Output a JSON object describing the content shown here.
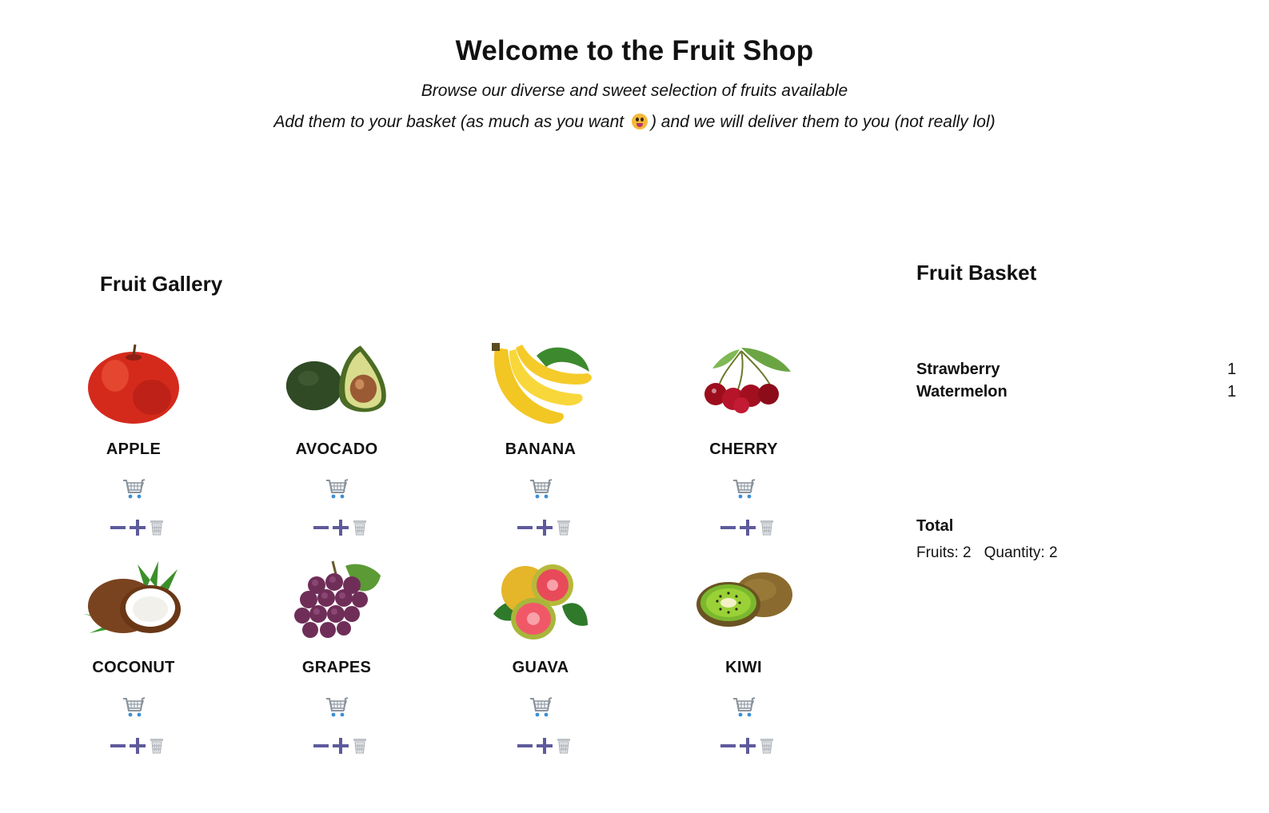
{
  "header": {
    "title": "Welcome to the Fruit Shop",
    "subtitle": "Browse our diverse and sweet selection of fruits available",
    "tagline_before": "Add them to your basket (as much as you want",
    "tagline_after": ") and we will deliver them to you (not really lol)"
  },
  "gallery": {
    "title": "Fruit Gallery",
    "fruits": [
      {
        "name": "APPLE"
      },
      {
        "name": "AVOCADO"
      },
      {
        "name": "BANANA"
      },
      {
        "name": "CHERRY"
      },
      {
        "name": "COCONUT"
      },
      {
        "name": "GRAPES"
      },
      {
        "name": "GUAVA"
      },
      {
        "name": "KIWI"
      }
    ]
  },
  "basket": {
    "title": "Fruit Basket",
    "items": [
      {
        "name": "Strawberry",
        "qty": "1"
      },
      {
        "name": "Watermelon",
        "qty": "1"
      }
    ],
    "total_label": "Total",
    "fruits_count": "Fruits: 2",
    "quantity_count": "Quantity: 2"
  },
  "colors": {
    "control": "#5e5a9c",
    "cart": "#9aa3ad",
    "cart_accent": "#3d8fd6"
  }
}
